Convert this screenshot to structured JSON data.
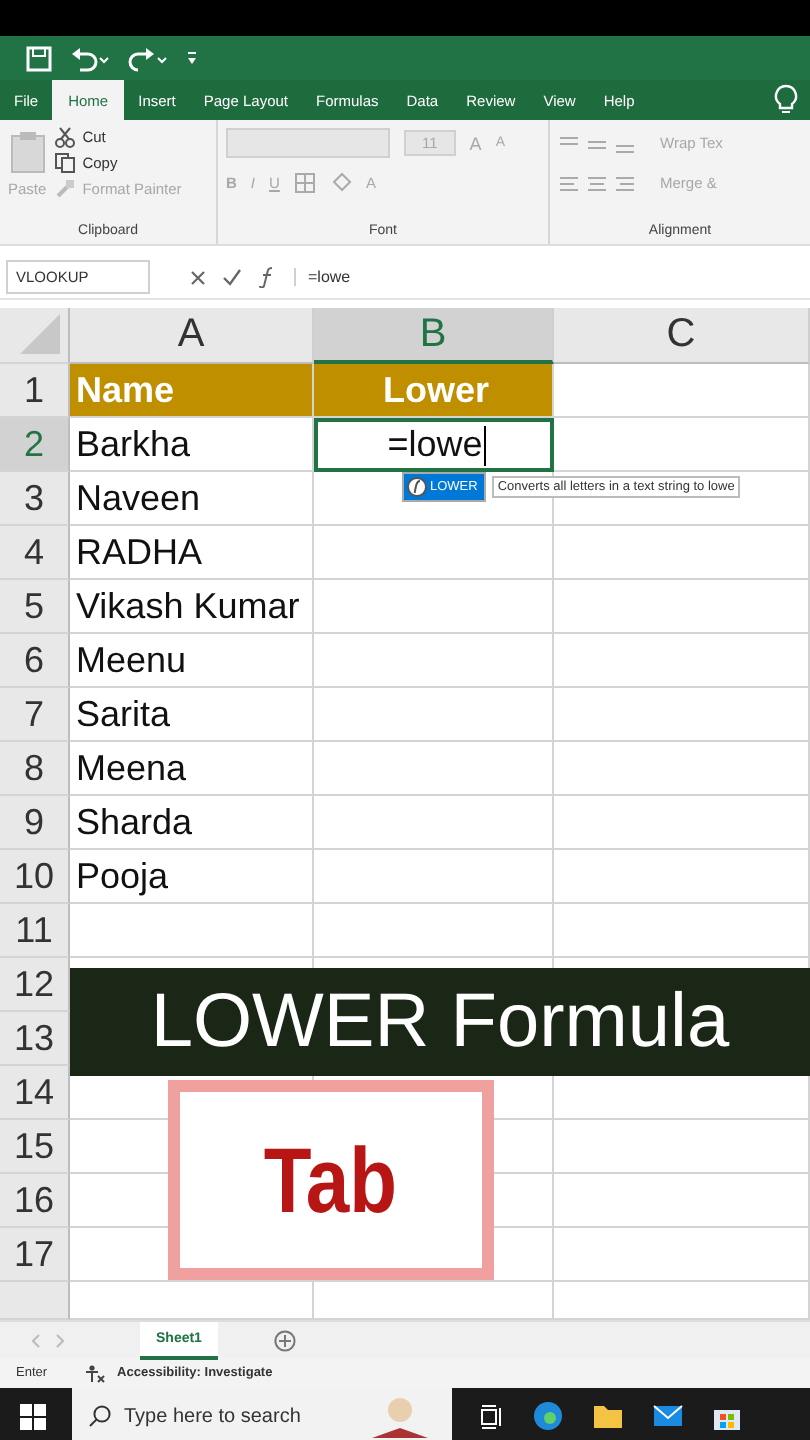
{
  "ribbon_tabs": [
    {
      "label": "File",
      "selected": false
    },
    {
      "label": "Home",
      "selected": true
    },
    {
      "label": "Insert",
      "selected": false
    },
    {
      "label": "Page Layout",
      "selected": false
    },
    {
      "label": "Formulas",
      "selected": false
    },
    {
      "label": "Data",
      "selected": false
    },
    {
      "label": "Review",
      "selected": false
    },
    {
      "label": "View",
      "selected": false
    },
    {
      "label": "Help",
      "selected": false
    }
  ],
  "clipboard": {
    "paste": "Paste",
    "cut": "Cut",
    "copy": "Copy",
    "format_painter": "Format Painter",
    "label": "Clipboard"
  },
  "font": {
    "size": "11",
    "grow": "A",
    "shrink": "A",
    "bold": "B",
    "italic": "I",
    "underline": "U",
    "font_color": "A",
    "label": "Font"
  },
  "alignment": {
    "wrap": "Wrap Tex",
    "merge": "Merge &",
    "label": "Alignment"
  },
  "formula_bar": {
    "name_box": "VLOOKUP",
    "formula": "=lowe"
  },
  "columns": [
    {
      "label": "A",
      "selected": false
    },
    {
      "label": "B",
      "selected": true
    },
    {
      "label": "C",
      "selected": false
    }
  ],
  "rows": [
    {
      "number": "1",
      "selected": false,
      "kind": "header",
      "a": "Name",
      "b": "Lower"
    },
    {
      "number": "2",
      "selected": true,
      "kind": "data",
      "a": "Barkha",
      "b": "=lowe"
    },
    {
      "number": "3",
      "selected": false,
      "kind": "data",
      "a": "Naveen"
    },
    {
      "number": "4",
      "selected": false,
      "kind": "data",
      "a": "RADHA"
    },
    {
      "number": "5",
      "selected": false,
      "kind": "data",
      "a": "Vikash Kumar"
    },
    {
      "number": "6",
      "selected": false,
      "kind": "data",
      "a": "Meenu"
    },
    {
      "number": "7",
      "selected": false,
      "kind": "data",
      "a": "Sarita"
    },
    {
      "number": "8",
      "selected": false,
      "kind": "data",
      "a": "Meena"
    },
    {
      "number": "9",
      "selected": false,
      "kind": "data",
      "a": "Sharda"
    },
    {
      "number": "10",
      "selected": false,
      "kind": "data",
      "a": "Pooja"
    },
    {
      "number": "11",
      "selected": false,
      "kind": "empty"
    },
    {
      "number": "12",
      "selected": false,
      "kind": "empty"
    },
    {
      "number": "13",
      "selected": false,
      "kind": "empty"
    },
    {
      "number": "14",
      "selected": false,
      "kind": "empty"
    },
    {
      "number": "15",
      "selected": false,
      "kind": "empty"
    },
    {
      "number": "16",
      "selected": false,
      "kind": "empty"
    },
    {
      "number": "17",
      "selected": false,
      "kind": "empty"
    }
  ],
  "autocomplete": {
    "suggestion": "LOWER",
    "tooltip": "Converts all letters in a text string to lowe"
  },
  "overlay": {
    "banner": "LOWER Formula",
    "label": "Tab"
  },
  "sheet_tabs": [
    {
      "label": "Sheet1",
      "selected": true
    }
  ],
  "status_bar": {
    "mode": "Enter",
    "accessibility": "Accessibility: Investigate"
  },
  "taskbar": {
    "search_placeholder": "Type here to search"
  }
}
